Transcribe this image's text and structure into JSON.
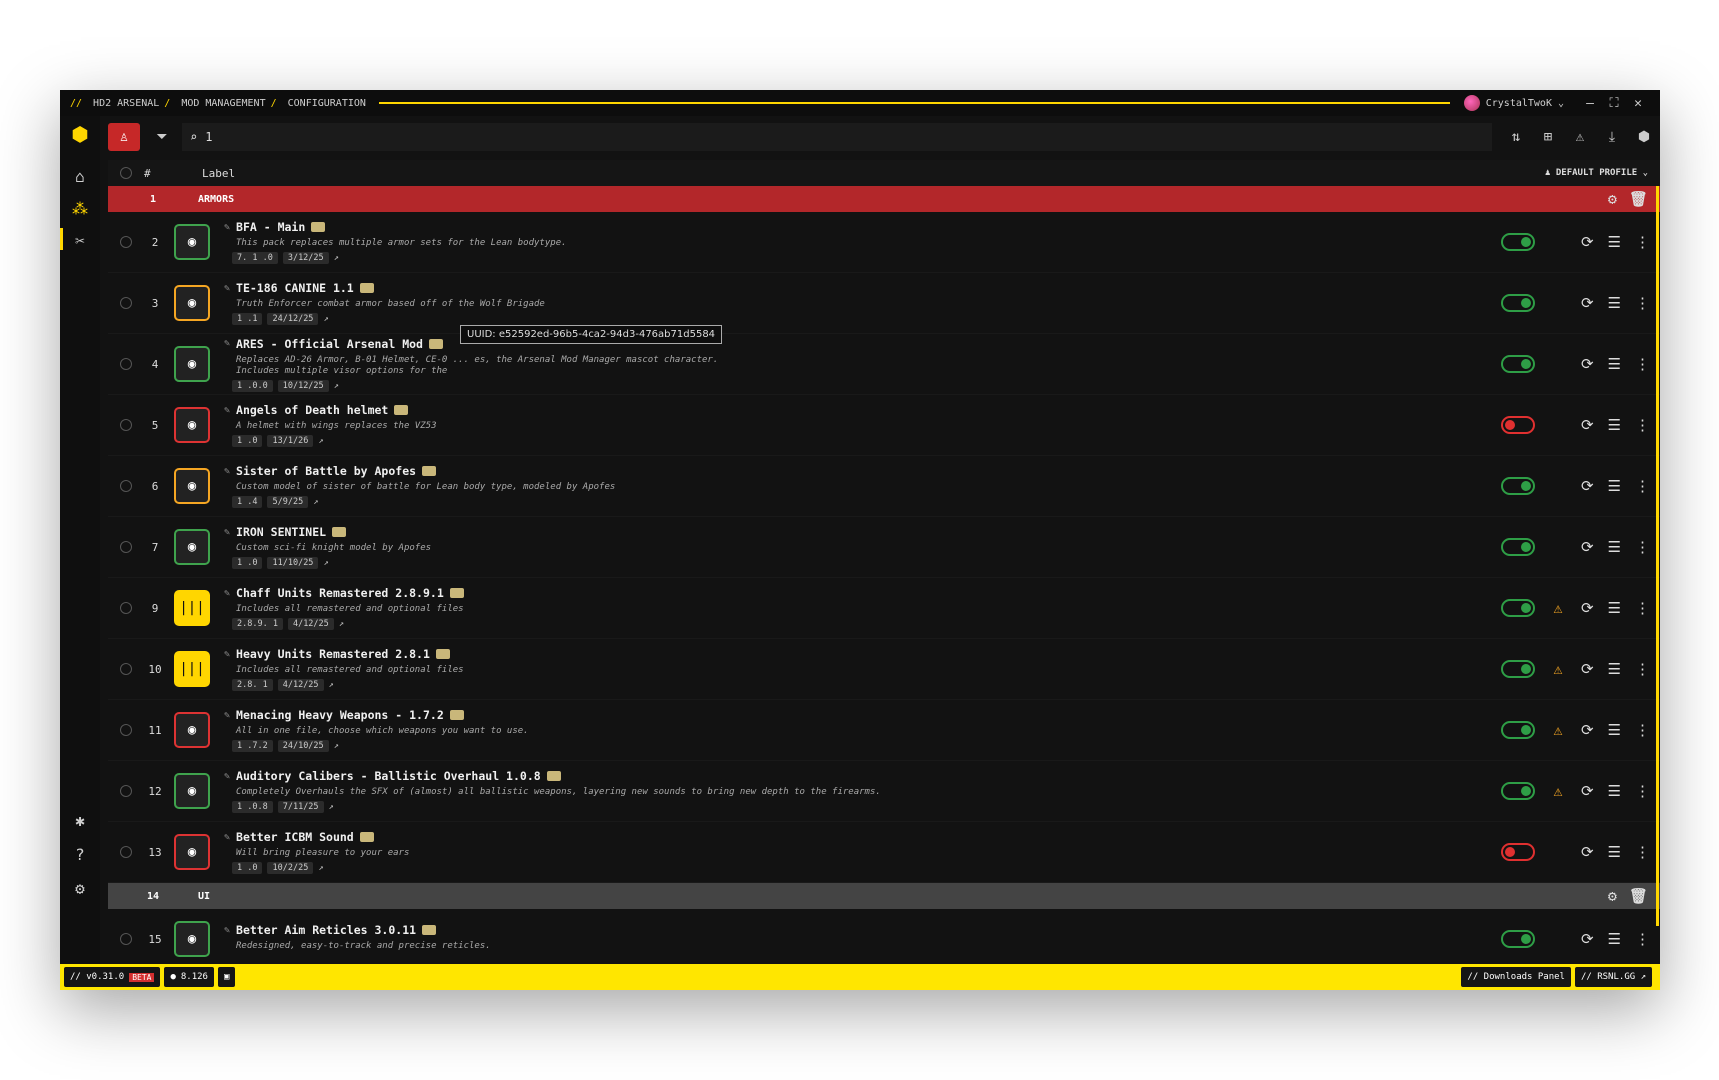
{
  "titlebar": {
    "crumbs": [
      "HD2 ARSENAL",
      "MOD MANAGEMENT",
      "CONFIGURATION"
    ],
    "user": "CrystalTwoK"
  },
  "search": {
    "value": "1"
  },
  "header": {
    "hash": "#",
    "label": "Label",
    "profile": "DEFAULT PROFILE"
  },
  "categories": [
    {
      "num": "1",
      "name": "ARMORS"
    },
    {
      "num": "14",
      "name": "UI"
    }
  ],
  "mods": [
    {
      "idx": "2",
      "title": "BFA - Main",
      "desc": "This pack replaces multiple armor sets for the Lean bodytype.",
      "ver": "7. 1 .0",
      "date": "3/12/25",
      "enabled": true,
      "warn": false
    },
    {
      "idx": "3",
      "title": "TE-186 CANINE 1.1",
      "desc": "Truth Enforcer combat armor based off of the Wolf Brigade",
      "ver": "1 .1",
      "date": "24/12/25",
      "enabled": true,
      "warn": false
    },
    {
      "idx": "4",
      "title": "ARES - Official Arsenal Mod",
      "desc": "Replaces AD-26 Armor, B-01 Helmet, CE-0 ... es, the Arsenal Mod Manager mascot character.",
      "desc2": "Includes multiple visor options for the",
      "ver": "1 .0.0",
      "date": "10/12/25",
      "enabled": true,
      "warn": false
    },
    {
      "idx": "5",
      "title": "Angels of Death helmet",
      "desc": "A helmet with wings replaces the VZ53",
      "ver": "1 .0",
      "date": "13/1/26",
      "enabled": false,
      "warn": false
    },
    {
      "idx": "6",
      "title": "Sister of Battle by Apofes",
      "desc": "Custom model of sister of battle for Lean body type, modeled by Apofes",
      "ver": "1 .4",
      "date": "5/9/25",
      "enabled": true,
      "warn": false
    },
    {
      "idx": "7",
      "title": "IRON SENTINEL",
      "desc": "Custom sci-fi knight model by Apofes",
      "ver": "1 .0",
      "date": "11/10/25",
      "enabled": true,
      "warn": false
    },
    {
      "idx": "9",
      "title": "Chaff Units Remastered 2.8.9.1",
      "desc": "Includes all remastered and optional files",
      "ver": "2.8.9. 1",
      "date": "4/12/25",
      "enabled": true,
      "warn": true
    },
    {
      "idx": "10",
      "title": "Heavy Units Remastered 2.8.1",
      "desc": "Includes all remastered and optional files",
      "ver": "2.8. 1",
      "date": "4/12/25",
      "enabled": true,
      "warn": true
    },
    {
      "idx": "11",
      "title": "Menacing Heavy Weapons - 1.7.2",
      "desc": "All in one file, choose which weapons you want to use.",
      "ver": "1 .7.2",
      "date": "24/10/25",
      "enabled": true,
      "warn": true
    },
    {
      "idx": "12",
      "title": "Auditory Calibers - Ballistic Overhaul 1.0.8",
      "desc": "Completely Overhauls the SFX of (almost) all ballistic weapons, layering new sounds to bring new depth to the firearms.",
      "ver": "1 .0.8",
      "date": "7/11/25",
      "enabled": true,
      "warn": true
    },
    {
      "idx": "13",
      "title": "Better ICBM Sound",
      "desc": "Will bring pleasure to your ears",
      "ver": "1 .0",
      "date": "10/2/25",
      "enabled": false,
      "warn": false
    },
    {
      "idx": "15",
      "title": "Better Aim Reticles 3.0.11",
      "desc": "Redesigned, easy-to-track and precise reticles.",
      "ver": "",
      "date": "",
      "enabled": true,
      "warn": false
    }
  ],
  "tooltip": "UUID: e52592ed-96b5-4ca2-94d3-476ab71d5584",
  "status": {
    "version": "// v0.31.0",
    "beta": "BETA",
    "coins": "8.126",
    "downloads": "// Downloads Panel",
    "site": "// RSNL.GG ↗"
  },
  "colors": {
    "accent": "#ffd600",
    "danger": "#b3272a",
    "ok": "#2e9e46"
  }
}
